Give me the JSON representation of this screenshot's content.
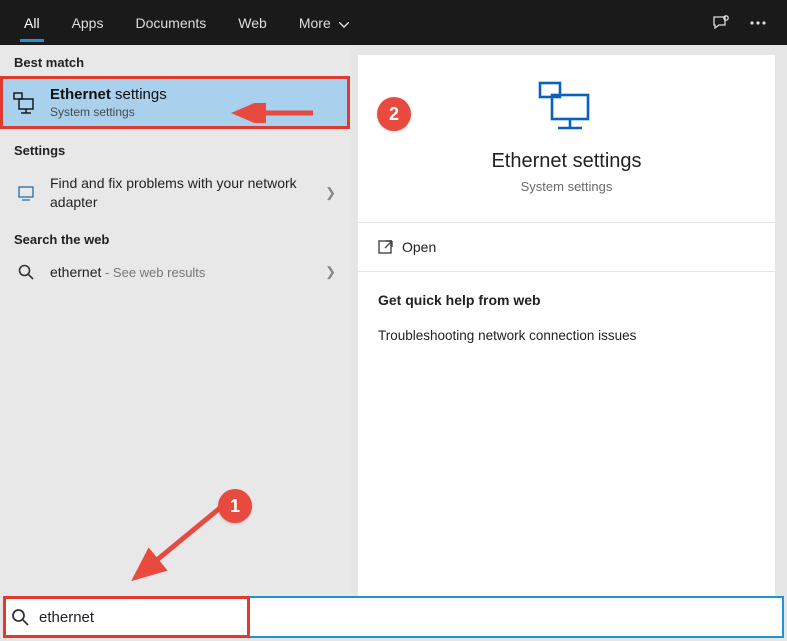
{
  "tabs": {
    "all": "All",
    "apps": "Apps",
    "documents": "Documents",
    "web": "Web",
    "more": "More"
  },
  "left": {
    "best_heading": "Best match",
    "best": {
      "title_bold": "Ethernet",
      "title_rest": " settings",
      "sub": "System settings"
    },
    "settings_heading": "Settings",
    "settings_item": "Find and fix problems with your network adapter",
    "web_heading": "Search the web",
    "web_item_text": "ethernet",
    "web_item_suffix": " - See web results"
  },
  "preview": {
    "title": "Ethernet settings",
    "sub": "System settings",
    "open": "Open",
    "quick_heading": "Get quick help from web",
    "quick_item": "Troubleshooting network connection issues"
  },
  "search": {
    "value": "ethernet"
  },
  "annotations": {
    "one": "1",
    "two": "2"
  }
}
